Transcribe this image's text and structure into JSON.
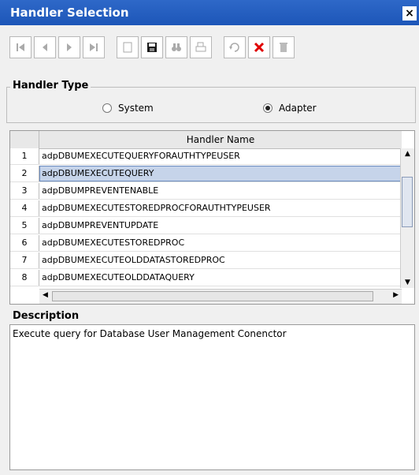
{
  "window": {
    "title": "Handler Selection",
    "close_label": "×"
  },
  "toolbar": {
    "buttons": [
      {
        "name": "first-record-icon"
      },
      {
        "name": "previous-record-icon"
      },
      {
        "name": "next-record-icon"
      },
      {
        "name": "last-record-icon"
      },
      {
        "name": "new-document-icon"
      },
      {
        "name": "save-icon"
      },
      {
        "name": "find-icon"
      },
      {
        "name": "print-icon"
      },
      {
        "name": "refresh-icon"
      },
      {
        "name": "delete-icon"
      },
      {
        "name": "trash-icon"
      }
    ],
    "accent_red": "#e00000"
  },
  "handler_type": {
    "label": "Handler Type",
    "options": [
      {
        "label": "System",
        "selected": false
      },
      {
        "label": "Adapter",
        "selected": true
      }
    ]
  },
  "table": {
    "column": "Handler Name",
    "selected_row": 2,
    "rows": [
      {
        "num": "1",
        "name": "adpDBUMEXECUTEQUERYFORAUTHTYPEUSER"
      },
      {
        "num": "2",
        "name": "adpDBUMEXECUTEQUERY"
      },
      {
        "num": "3",
        "name": "adpDBUMPREVENTENABLE"
      },
      {
        "num": "4",
        "name": "adpDBUMEXECUTESTOREDPROCFORAUTHTYPEUSER"
      },
      {
        "num": "5",
        "name": "adpDBUMPREVENTUPDATE"
      },
      {
        "num": "6",
        "name": "adpDBUMEXECUTESTOREDPROC"
      },
      {
        "num": "7",
        "name": "adpDBUMEXECUTEOLDDATASTOREDPROC"
      },
      {
        "num": "8",
        "name": "adpDBUMEXECUTEOLDDATAQUERY"
      }
    ]
  },
  "description": {
    "label": "Description",
    "text": "Execute query for Database User Management Conenctor"
  }
}
